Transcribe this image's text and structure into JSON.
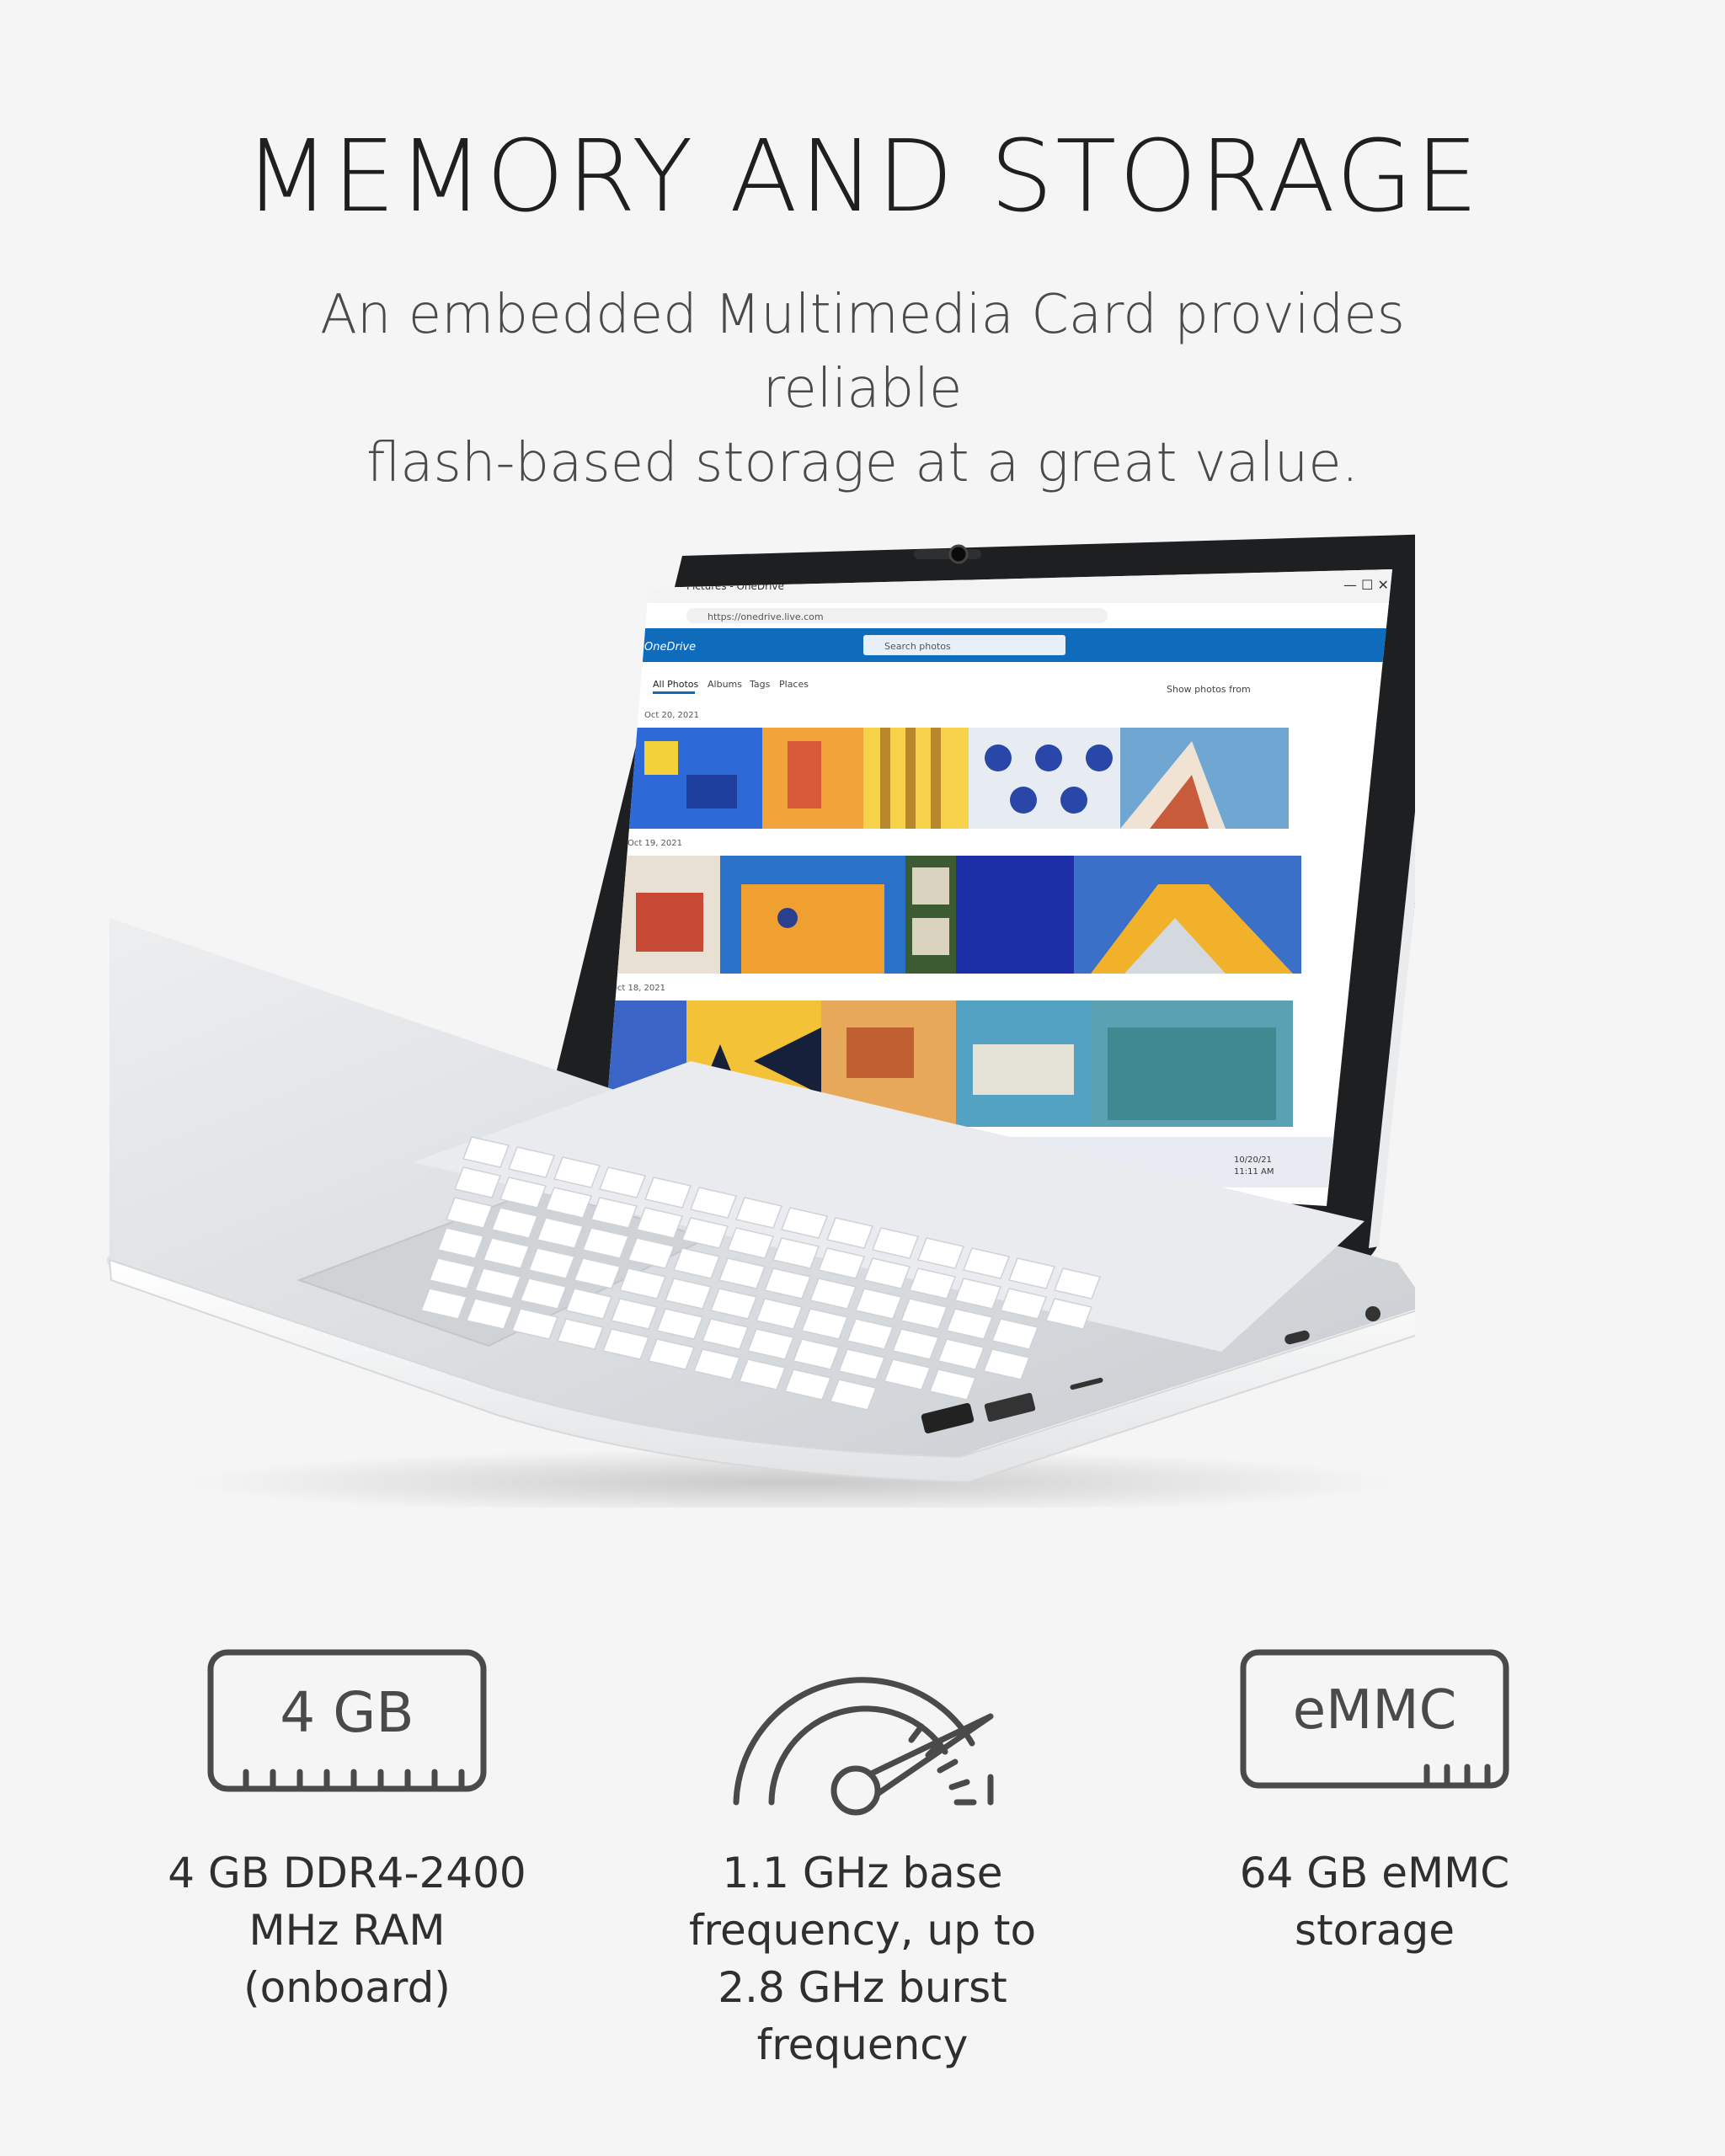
{
  "header": {
    "title": "MEMORY AND STORAGE",
    "subtitle_line1": "An embedded Multimedia Card provides reliable",
    "subtitle_line2": "flash-based storage at a great value."
  },
  "laptop_screen": {
    "browser_tab": "Pictures - OneDrive",
    "address": "https://onedrive.live.com",
    "app_name": "OneDrive",
    "search_placeholder": "Search photos",
    "nav_tabs": [
      "All Photos",
      "Albums",
      "Tags",
      "Places"
    ],
    "filter_label": "Show photos from",
    "dates": [
      "Oct 20, 2021",
      "Oct 19, 2021",
      "Oct 18, 2021"
    ],
    "clock_date": "10/20/21",
    "clock_time": "11:11 AM"
  },
  "features": [
    {
      "icon": "memory-module-icon",
      "icon_label": "4 GB",
      "caption_lines": [
        "4 GB DDR4-2400",
        "MHz RAM",
        "(onboard)"
      ]
    },
    {
      "icon": "speedometer-icon",
      "caption_lines": [
        "1.1 GHz base",
        "frequency, up to",
        "2.8 GHz burst",
        "frequency"
      ]
    },
    {
      "icon": "storage-chip-icon",
      "icon_label": "eMMC",
      "caption_lines": [
        "64 GB eMMC storage"
      ]
    }
  ],
  "colors": {
    "background": "#f5f5f5",
    "onedrive_blue": "#0f6cbd",
    "icon_stroke": "#4a4a4a"
  }
}
